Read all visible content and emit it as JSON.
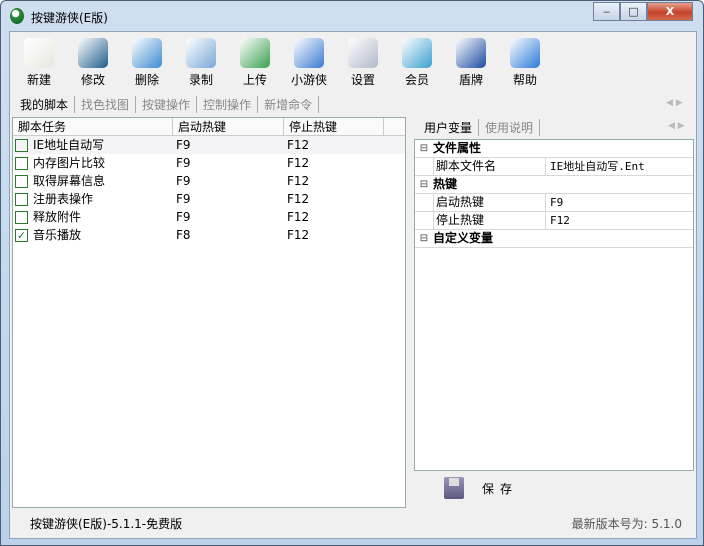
{
  "window": {
    "title": "按键游侠(E版)",
    "minimize": "‒",
    "maximize": "□",
    "close": "X"
  },
  "toolbar": [
    {
      "label": "新建",
      "icon": "new-icon",
      "color": "#e8e8e0"
    },
    {
      "label": "修改",
      "icon": "edit-icon",
      "color": "#1e5d8c"
    },
    {
      "label": "删除",
      "icon": "recycle-bin-icon",
      "color": "#3a8ad0"
    },
    {
      "label": "录制",
      "icon": "record-icon",
      "color": "#7aa8d8"
    },
    {
      "label": "上传",
      "icon": "upload-icon",
      "color": "#3aa050"
    },
    {
      "label": "小游侠",
      "icon": "messenger-icon",
      "color": "#3a7ad0"
    },
    {
      "label": "设置",
      "icon": "settings-icon",
      "color": "#b0b8c8"
    },
    {
      "label": "会员",
      "icon": "members-icon",
      "color": "#3aa0d0"
    },
    {
      "label": "盾牌",
      "icon": "shield-icon",
      "color": "#1a4aa0"
    },
    {
      "label": "帮助",
      "icon": "help-icon",
      "color": "#2a7ad8"
    }
  ],
  "tabs": [
    "我的脚本",
    "找色找图",
    "按键操作",
    "控制操作",
    "新增命令"
  ],
  "list": {
    "headers": [
      "脚本任务",
      "启动热键",
      "停止热键"
    ],
    "rows": [
      {
        "name": "IE地址自动写",
        "start": "F9",
        "stop": "F12",
        "checked": false
      },
      {
        "name": "内存图片比较",
        "start": "F9",
        "stop": "F12",
        "checked": false
      },
      {
        "name": "取得屏幕信息",
        "start": "F9",
        "stop": "F12",
        "checked": false
      },
      {
        "name": "注册表操作",
        "start": "F9",
        "stop": "F12",
        "checked": false
      },
      {
        "name": "释放附件",
        "start": "F9",
        "stop": "F12",
        "checked": false
      },
      {
        "name": "音乐播放",
        "start": "F8",
        "stop": "F12",
        "checked": true
      }
    ]
  },
  "right": {
    "tabs": [
      "用户变量",
      "使用说明"
    ],
    "grid": [
      {
        "category": "文件属性",
        "toggle": "⊟"
      },
      {
        "key": "脚本文件名",
        "value": "IE地址自动写.Ent"
      },
      {
        "category": "热键",
        "toggle": "⊟"
      },
      {
        "key": "启动热键",
        "value": "F9"
      },
      {
        "key": "停止热键",
        "value": "F12"
      },
      {
        "category": "自定义变量",
        "toggle": "⊟"
      }
    ],
    "save_label": "保存"
  },
  "status": {
    "left": "按键游侠(E版)-5.1.1-免费版",
    "right": "最新版本号为: 5.1.0"
  }
}
